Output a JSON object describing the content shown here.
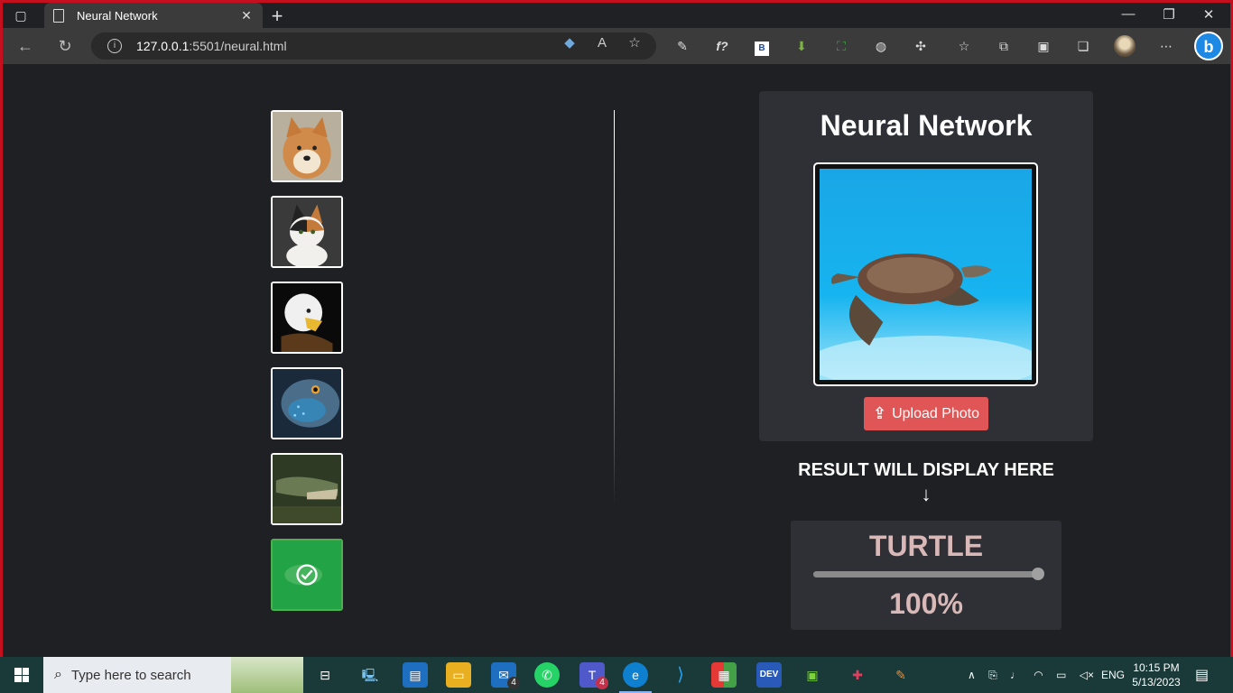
{
  "browser": {
    "tab_title": "Neural Network",
    "url_host": "127.0.0.1",
    "url_rest": ":5501/neural.html"
  },
  "page": {
    "title": "Neural Network",
    "upload_label": "Upload Photo",
    "result_label": "RESULT WILL DISPLAY HERE",
    "arrow": "↓",
    "result_class": "TURTLE",
    "result_percent": "100%",
    "confidence": 1.0
  },
  "thumbnails": [
    {
      "name": "dog",
      "selected": false
    },
    {
      "name": "cat",
      "selected": false
    },
    {
      "name": "eagle",
      "selected": false
    },
    {
      "name": "fish",
      "selected": false
    },
    {
      "name": "crocodile",
      "selected": false
    },
    {
      "name": "turtle",
      "selected": true
    }
  ],
  "taskbar": {
    "search_placeholder": "Type here to search",
    "language": "ENG",
    "time": "10:15 PM",
    "date": "5/13/2023",
    "mail_badge": "4",
    "teams_badge": "4"
  },
  "colors": {
    "accent_upload": "#e05656",
    "page_bg": "#1f2023",
    "card_bg": "#2e3036",
    "result_text": "#d9b8b8",
    "selected_border": "#4caf50"
  }
}
